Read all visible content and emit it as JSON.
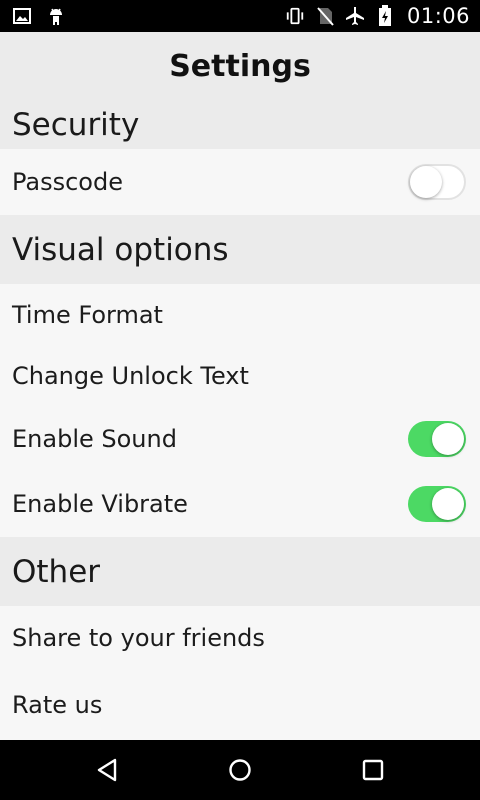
{
  "status_bar": {
    "time": "01:06",
    "left_icons": [
      "image-icon",
      "android-icon"
    ],
    "right_icons": [
      "vibrate-icon",
      "no-sim-icon",
      "airplane-icon",
      "battery-charging-icon"
    ]
  },
  "title": "Settings",
  "sections": {
    "security": {
      "header": "Security",
      "passcode": {
        "label": "Passcode",
        "enabled": false
      }
    },
    "visual": {
      "header": "Visual options",
      "time_format": {
        "label": "Time Format"
      },
      "unlock_text": {
        "label": "Change Unlock Text"
      },
      "sound": {
        "label": "Enable Sound",
        "enabled": true
      },
      "vibrate": {
        "label": "Enable Vibrate",
        "enabled": true
      }
    },
    "other": {
      "header": "Other",
      "share": {
        "label": "Share to your friends"
      },
      "rate": {
        "label": "Rate us"
      }
    }
  },
  "nav_bar": {
    "buttons": [
      "back-icon",
      "home-icon",
      "recents-icon"
    ]
  },
  "colors": {
    "toggle_on": "#4cd964",
    "header_bg": "#ebebeb",
    "row_bg": "#f7f7f7"
  }
}
